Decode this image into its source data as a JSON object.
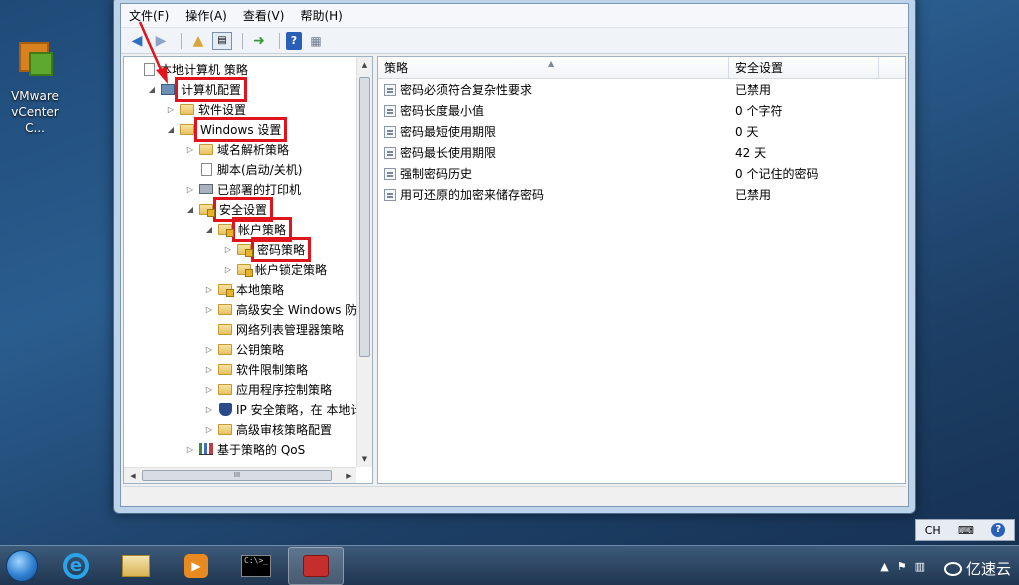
{
  "desktop": {
    "top_label": "______",
    "icon_label_line1": "VMware",
    "icon_label_line2": "vCenter C..."
  },
  "menu": [
    "文件(F)",
    "操作(A)",
    "查看(V)",
    "帮助(H)"
  ],
  "tree": [
    {
      "label": "本地计算机 策略",
      "indent": 0,
      "toggle": "",
      "icon": "doc-icon",
      "highlight": false
    },
    {
      "label": "计算机配置",
      "indent": 1,
      "toggle": "◢",
      "icon": "computer-icon",
      "highlight": true
    },
    {
      "label": "软件设置",
      "indent": 2,
      "toggle": "▷",
      "icon": "folder-icon",
      "highlight": false
    },
    {
      "label": "Windows 设置",
      "indent": 2,
      "toggle": "◢",
      "icon": "folder-icon",
      "highlight": true
    },
    {
      "label": "域名解析策略",
      "indent": 3,
      "toggle": "▷",
      "icon": "folder-icon",
      "highlight": false
    },
    {
      "label": "脚本(启动/关机)",
      "indent": 3,
      "toggle": "",
      "icon": "doc-icon",
      "highlight": false
    },
    {
      "label": "已部署的打印机",
      "indent": 3,
      "toggle": "▷",
      "icon": "printer-icon",
      "highlight": false
    },
    {
      "label": "安全设置",
      "indent": 3,
      "toggle": "◢",
      "icon": "folder-lock-icon",
      "highlight": true
    },
    {
      "label": "帐户策略",
      "indent": 4,
      "toggle": "◢",
      "icon": "folder-lock-icon",
      "highlight": true
    },
    {
      "label": "密码策略",
      "indent": 5,
      "toggle": "▷",
      "icon": "folder-lock-icon",
      "highlight": true
    },
    {
      "label": "帐户锁定策略",
      "indent": 5,
      "toggle": "▷",
      "icon": "folder-lock-icon",
      "highlight": false
    },
    {
      "label": "本地策略",
      "indent": 4,
      "toggle": "▷",
      "icon": "folder-lock-icon",
      "highlight": false
    },
    {
      "label": "高级安全 Windows 防火",
      "indent": 4,
      "toggle": "▷",
      "icon": "folder-icon",
      "highlight": false
    },
    {
      "label": "网络列表管理器策略",
      "indent": 4,
      "toggle": "",
      "icon": "folder-icon",
      "highlight": false
    },
    {
      "label": "公钥策略",
      "indent": 4,
      "toggle": "▷",
      "icon": "folder-icon",
      "highlight": false
    },
    {
      "label": "软件限制策略",
      "indent": 4,
      "toggle": "▷",
      "icon": "folder-icon",
      "highlight": false
    },
    {
      "label": "应用程序控制策略",
      "indent": 4,
      "toggle": "▷",
      "icon": "folder-icon",
      "highlight": false
    },
    {
      "label": "IP 安全策略，在 本地计算",
      "indent": 4,
      "toggle": "▷",
      "icon": "shield-icon",
      "highlight": false
    },
    {
      "label": "高级审核策略配置",
      "indent": 4,
      "toggle": "▷",
      "icon": "folder-icon",
      "highlight": false
    },
    {
      "label": "基于策略的 QoS",
      "indent": 3,
      "toggle": "▷",
      "icon": "chart-icon",
      "highlight": false
    }
  ],
  "list": {
    "col_policy": "策略",
    "col_setting": "安全设置",
    "rows": [
      {
        "policy": "密码必须符合复杂性要求",
        "setting": "已禁用"
      },
      {
        "policy": "密码长度最小值",
        "setting": "0 个字符"
      },
      {
        "policy": "密码最短使用期限",
        "setting": "0 天"
      },
      {
        "policy": "密码最长使用期限",
        "setting": "42 天"
      },
      {
        "policy": "强制密码历史",
        "setting": "0 个记住的密码"
      },
      {
        "policy": "用可还原的加密来储存密码",
        "setting": "已禁用"
      }
    ]
  },
  "hscroll_grip": "III",
  "taskbar": {
    "cmd_text": "C:\\>_",
    "media_glyph": "▶",
    "ie_glyph": "e"
  },
  "langbar": {
    "lang": "CH",
    "help": "?"
  },
  "watermark": "亿速云",
  "colors": {
    "highlight_red": "#e0141c",
    "taskbar": "#2a4563"
  }
}
